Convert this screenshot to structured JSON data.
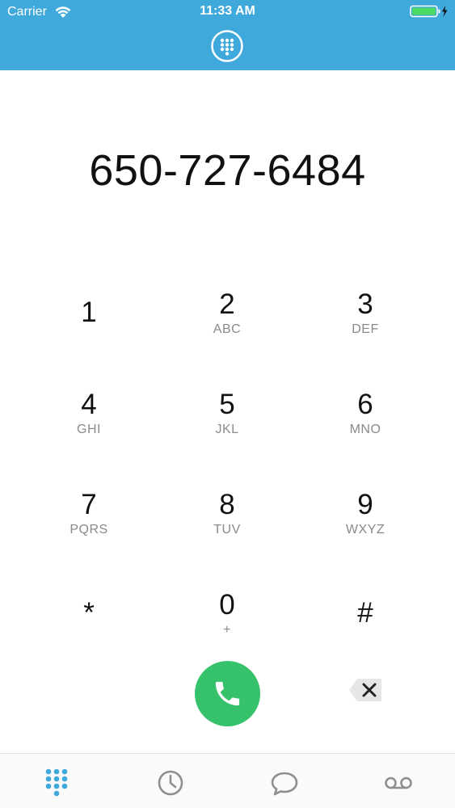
{
  "status_bar": {
    "carrier": "Carrier",
    "time": "11:33 AM",
    "wifi_icon": "wifi-icon",
    "battery_icon": "battery-charging-icon"
  },
  "header": {
    "toggle_icon": "keypad-grid-icon",
    "background_color": "#3fa9dc"
  },
  "display": {
    "number": "650-727-6484"
  },
  "keypad": {
    "keys": [
      {
        "digit": "1",
        "letters": ""
      },
      {
        "digit": "2",
        "letters": "ABC"
      },
      {
        "digit": "3",
        "letters": "DEF"
      },
      {
        "digit": "4",
        "letters": "GHI"
      },
      {
        "digit": "5",
        "letters": "JKL"
      },
      {
        "digit": "6",
        "letters": "MNO"
      },
      {
        "digit": "7",
        "letters": "PQRS"
      },
      {
        "digit": "8",
        "letters": "TUV"
      },
      {
        "digit": "9",
        "letters": "WXYZ"
      },
      {
        "digit": "*",
        "letters": ""
      },
      {
        "digit": "0",
        "letters": "+"
      },
      {
        "digit": "#",
        "letters": ""
      }
    ]
  },
  "actions": {
    "call_icon": "phone-icon",
    "call_color": "#35c26b",
    "delete_icon": "backspace-icon"
  },
  "tabbar": {
    "tabs": [
      {
        "icon": "keypad-grid-icon",
        "active": true
      },
      {
        "icon": "clock-icon",
        "active": false
      },
      {
        "icon": "chat-bubble-icon",
        "active": false
      },
      {
        "icon": "voicemail-icon",
        "active": false
      }
    ],
    "active_color": "#3fa9dc",
    "inactive_color": "#8e8e93"
  }
}
